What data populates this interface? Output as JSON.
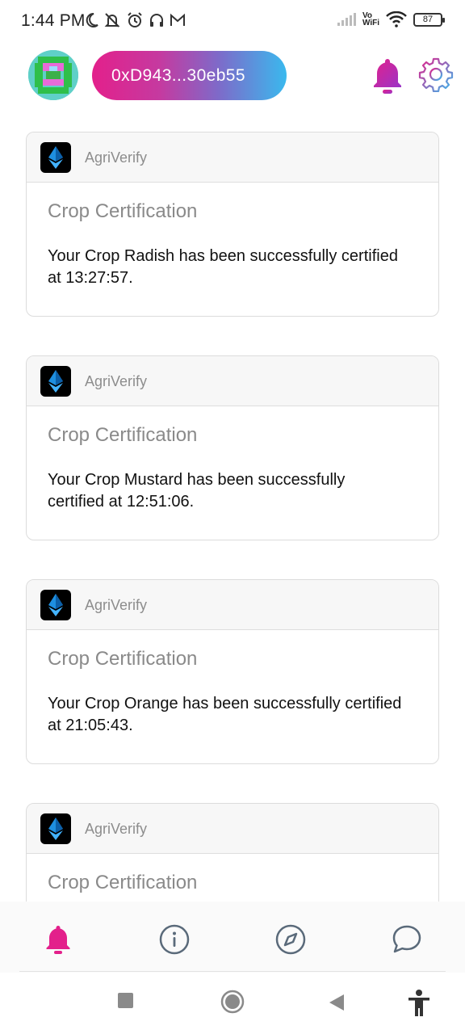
{
  "status_bar": {
    "time": "1:44 PM",
    "vowifi_line1": "Vo",
    "vowifi_line2": "WiFi",
    "battery": "87"
  },
  "header": {
    "wallet_address": "0xD943...30eb55"
  },
  "notifications": [
    {
      "app_name": "AgriVerify",
      "title": "Crop Certification",
      "message": "Your Crop Radish has been successfully certified at 13:27:57."
    },
    {
      "app_name": "AgriVerify",
      "title": "Crop Certification",
      "message": "Your Crop Mustard has been successfully certified at 12:51:06."
    },
    {
      "app_name": "AgriVerify",
      "title": "Crop Certification",
      "message": "Your Crop Orange has been successfully certified at 21:05:43."
    },
    {
      "app_name": "AgriVerify",
      "title": "Crop Certification",
      "message": ""
    }
  ],
  "bottom_nav": {
    "items": [
      {
        "icon": "bell-icon",
        "active": true
      },
      {
        "icon": "info-icon",
        "active": false
      },
      {
        "icon": "compass-icon",
        "active": false
      },
      {
        "icon": "chat-bubble-icon",
        "active": false
      }
    ]
  },
  "colors": {
    "accent": "#e3208b",
    "gradient_end": "#3ab9ee",
    "nav_inactive": "#5a6a7a"
  }
}
